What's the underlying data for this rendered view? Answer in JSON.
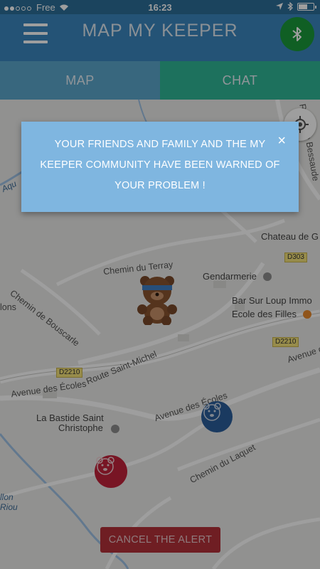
{
  "status_bar": {
    "carrier": "Free",
    "time": "16:23",
    "signal_icon": "signal-dots-icon",
    "wifi_icon": "wifi-icon",
    "location_icon": "location-arrow-icon",
    "bluetooth_icon": "bluetooth-icon",
    "battery_icon": "battery-icon"
  },
  "header": {
    "title": "MAP MY KEEPER",
    "menu_icon": "hamburger-menu-icon",
    "bluetooth_button_icon": "bluetooth-icon",
    "bluetooth_color": "#1a9a3a"
  },
  "tabs": [
    {
      "label": "MAP",
      "color": "#5ba7cc"
    },
    {
      "label": "CHAT",
      "color": "#2fb696"
    }
  ],
  "map": {
    "streets": {
      "chemin_du_terray": "Chemin du Terray",
      "chemin_de_bouscarle": "Chemin de Bouscarle",
      "avenue_des_ecoles_left": "Avenue des Écoles",
      "avenue_des_ecoles_center": "Avenue des Écoles",
      "chemin_du_laquet": "Chemin du Laquet",
      "route_saint_michel": "Route Saint-Michel",
      "avenue_right": "Avenue de",
      "route_top_right": "Route de Bessaude"
    },
    "partial_labels": {
      "lions": "lons",
      "aqu": "Aqu"
    },
    "places": {
      "chateau": "Chateau de G",
      "gendarmerie": "Gendarmerie",
      "bar": "Bar Sur Loup Immo",
      "ecole": "Ecole des Filles",
      "bastide_line1": "La Bastide Saint",
      "bastide_line2": "Christophe"
    },
    "water": {
      "line1": "llon",
      "line2": "Riou"
    },
    "road_badges": {
      "d303": "D303",
      "d2210_right": "D2210",
      "d2210_left": "D2210"
    },
    "markers": {
      "keeper": "teddy-bear-keeper-icon",
      "blue": "bear-face-blue-marker-icon",
      "red": "bear-face-red-marker-icon",
      "locate": "target-locate-icon"
    }
  },
  "dialog": {
    "message": "YOUR FRIENDS AND FAMILY AND THE MY KEEPER COMMUNITY HAVE BEEN WARNED OF YOUR PROBLEM !",
    "close_label": "×",
    "color": "#7fb6e0"
  },
  "cancel_button": {
    "label": "CANCEL THE ALERT",
    "color": "#b33139"
  }
}
